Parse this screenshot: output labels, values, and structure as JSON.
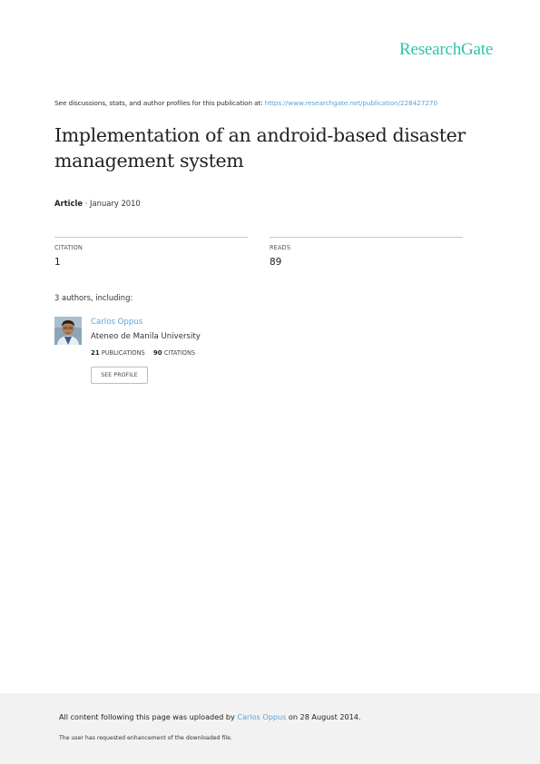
{
  "brand": {
    "logo_text": "ResearchGate",
    "color": "#2ec4a6"
  },
  "header": {
    "see_text": "See discussions, stats, and author profiles for this publication at:",
    "url": "https://www.researchgate.net/publication/228427270"
  },
  "publication": {
    "title": "Implementation of an android-based disaster management system",
    "type": "Article",
    "separator": "·",
    "date": "January 2010"
  },
  "stats": {
    "citations": {
      "label": "CITATION",
      "value": "1"
    },
    "reads": {
      "label": "READS",
      "value": "89"
    }
  },
  "authors": {
    "heading": "3 authors, including:",
    "items": [
      {
        "name": "Carlos Oppus",
        "institution": "Ateneo de Manila University",
        "publications_count": "21",
        "publications_label": "PUBLICATIONS",
        "citations_count": "90",
        "citations_label": "CITATIONS",
        "profile_button": "SEE PROFILE"
      }
    ]
  },
  "footer": {
    "upload_prefix": "All content following this page was uploaded by",
    "uploader": "Carlos Oppus",
    "upload_suffix": "on 28 August 2014.",
    "note": "The user has requested enhancement of the downloaded file."
  },
  "colors": {
    "link": "#5ba4d6",
    "footer_bg": "#f2f2f2"
  }
}
